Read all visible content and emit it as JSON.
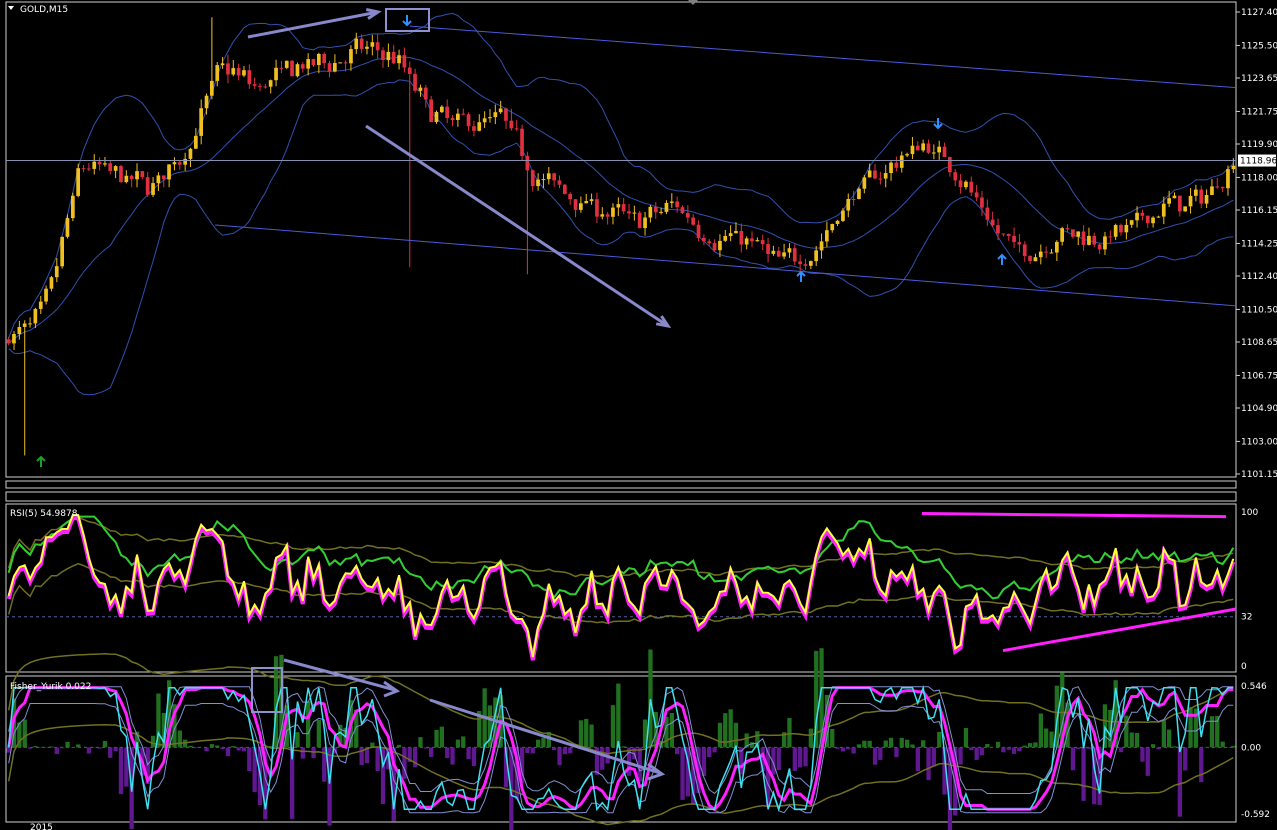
{
  "header": {
    "symbol_label": "GOLD,M15"
  },
  "price_axis": {
    "ticks": [
      "1127.40",
      "1125.50",
      "1123.65",
      "1121.75",
      "1119.90",
      "1118.00",
      "1116.15",
      "1114.25",
      "1112.40",
      "1110.50",
      "1108.65",
      "1106.75",
      "1104.90",
      "1103.00",
      "1101.15"
    ],
    "current_price": "1118.96"
  },
  "rsi_panel": {
    "label": "RSI(5) 54.9878",
    "ticks": [
      "100",
      "32",
      "0"
    ]
  },
  "fisher_panel": {
    "label": "Fisher_Yurik 0.022",
    "ticks": [
      "0.546",
      "0.00",
      "-0.592"
    ]
  },
  "time_axis": {
    "first_label": "2015"
  },
  "colors": {
    "bull_candle": "#f0c020",
    "bear_candle": "#e03040",
    "bollinger": "#3050b0",
    "channel": "#4a5ad8",
    "trend_arrow": "#8888cc",
    "rsi_yellow": "#ffff40",
    "rsi_magenta": "#ff20ff",
    "rsi_green": "#30d030",
    "fisher_cyan": "#40e0f0",
    "fisher_hist_pos": "#207020",
    "fisher_hist_neg": "#601890",
    "olive": "#707020"
  },
  "chart_data": [
    {
      "type": "candlestick",
      "title": "GOLD,M15",
      "ylim": [
        1101.15,
        1127.4
      ],
      "current_price": 1118.96,
      "trend": [
        1108.8,
        1110.5,
        1119,
        1118,
        1117.5,
        1119.5,
        1124.5,
        1123,
        1124.2,
        1124.5,
        1125.3,
        1124.8,
        1121.5,
        1121,
        1121.5,
        1118,
        1117,
        1116,
        1115.5,
        1116.5,
        1114.5,
        1114.5,
        1113,
        1114,
        1117,
        1118.5,
        1120,
        1118.6,
        1115,
        1113.5,
        1115,
        1114.6,
        1115,
        1116.5,
        1116.6,
        1119.2
      ],
      "annotations": [
        "up-arrow at low",
        "down-arrow at high",
        "up-arrow",
        "down-arrow",
        "up-arrow"
      ]
    },
    {
      "type": "line",
      "title": "RSI(5) 54.9878",
      "ylim": [
        0,
        100
      ],
      "levels": [
        100,
        32,
        0
      ],
      "value": 54.9878
    },
    {
      "type": "line",
      "title": "Fisher_Yurik 0.022",
      "ylim": [
        -0.592,
        0.546
      ],
      "levels": [
        0.546,
        0.0,
        -0.592
      ],
      "value": 0.022
    }
  ]
}
